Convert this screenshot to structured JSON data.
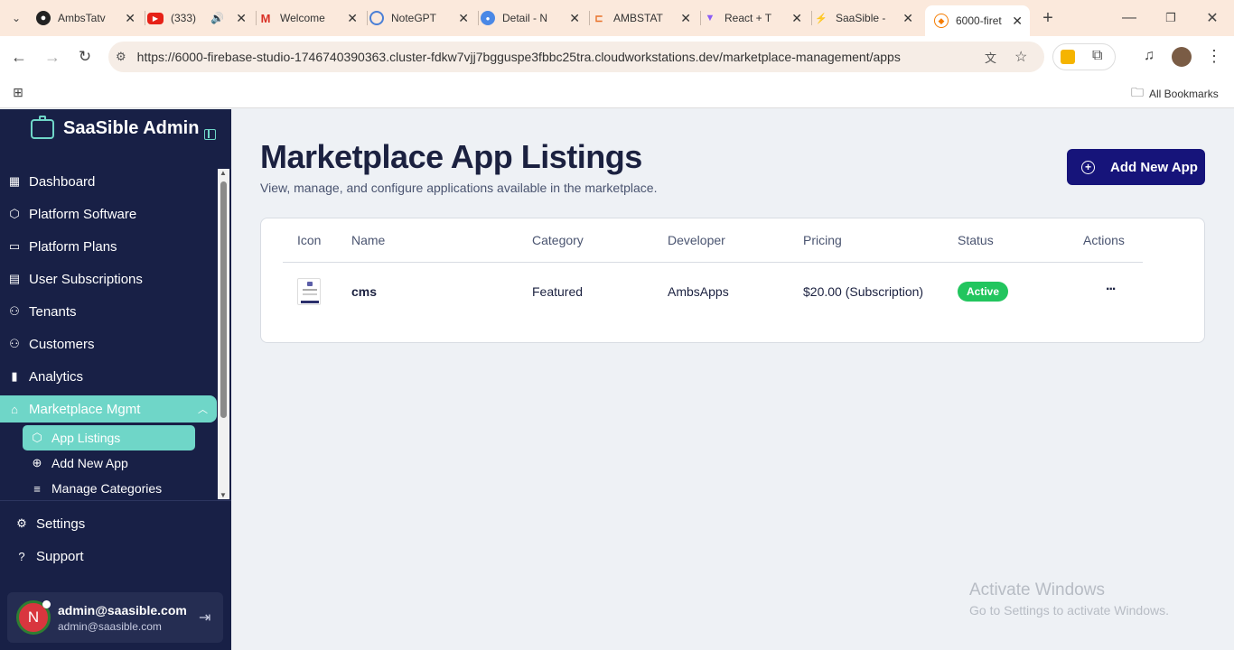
{
  "browser": {
    "tabs": [
      {
        "title": "AmbsTatv",
        "icon": "github-icon"
      },
      {
        "title": "(333)",
        "icon": "youtube-icon"
      },
      {
        "title": "Welcome",
        "icon": "gmail-icon"
      },
      {
        "title": "NoteGPT",
        "icon": "notegpt-icon"
      },
      {
        "title": "Detail - N",
        "icon": "chrome-icon"
      },
      {
        "title": "AMBSTAT",
        "icon": "ambstat-icon"
      },
      {
        "title": "React + T",
        "icon": "vite-icon"
      },
      {
        "title": "SaaSible -",
        "icon": "firebase-icon"
      },
      {
        "title": "6000-firet",
        "icon": "firebase-studio-icon"
      }
    ],
    "url": "https://6000-firebase-studio-1746740390363.cluster-fdkw7vjj7bgguspe3fbbc25tra.cloudworkstations.dev/marketplace-management/apps",
    "bookmarks_label": "All Bookmarks"
  },
  "sidebar": {
    "brand": "SaaSible Admin",
    "items": [
      {
        "label": "Dashboard",
        "icon": "dashboard-icon"
      },
      {
        "label": "Platform Software",
        "icon": "package-icon"
      },
      {
        "label": "Platform Plans",
        "icon": "card-icon"
      },
      {
        "label": "User Subscriptions",
        "icon": "subscriptions-icon"
      },
      {
        "label": "Tenants",
        "icon": "users-icon"
      },
      {
        "label": "Customers",
        "icon": "user-icon"
      },
      {
        "label": "Analytics",
        "icon": "bar-chart-icon"
      },
      {
        "label": "Marketplace Mgmt",
        "icon": "store-icon"
      }
    ],
    "sub_items": [
      {
        "label": "App Listings",
        "icon": "package-icon"
      },
      {
        "label": "Add New App",
        "icon": "plus-circle-icon"
      },
      {
        "label": "Manage Categories",
        "icon": "filter-icon"
      }
    ],
    "footer_items": [
      {
        "label": "Settings",
        "icon": "gear-icon"
      },
      {
        "label": "Support",
        "icon": "help-icon"
      }
    ],
    "user": {
      "avatar_letter": "N",
      "name": "admin@saasible.com",
      "email": "admin@saasible.com"
    }
  },
  "main": {
    "title": "Marketplace App Listings",
    "subtitle": "View, manage, and configure applications available in the marketplace.",
    "add_button": "Add New App",
    "table": {
      "headers": [
        "Icon",
        "Name",
        "Category",
        "Developer",
        "Pricing",
        "Status",
        "Actions"
      ],
      "rows": [
        {
          "name": "cms",
          "category": "Featured",
          "developer": "AmbsApps",
          "pricing": "$20.00 (Subscription)",
          "status": "Active",
          "actions": "..."
        }
      ]
    }
  },
  "watermark": {
    "line1": "Activate Windows",
    "line2": "Go to Settings to activate Windows."
  },
  "colors": {
    "sidebar_bg": "#182046",
    "accent": "#6fd6c8",
    "primary_button": "#16147a",
    "status_active": "#22c55e"
  }
}
